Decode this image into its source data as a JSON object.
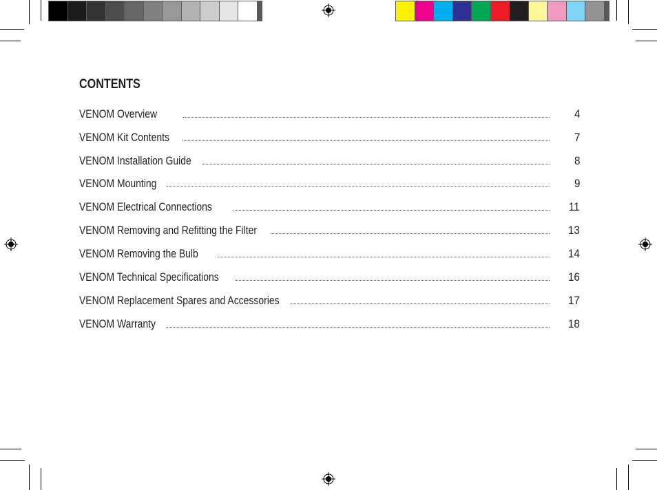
{
  "document": {
    "title": "CONTENTS",
    "toc": [
      {
        "label": "VENOM Overview",
        "page": "4"
      },
      {
        "label": "VENOM Kit Contents",
        "page": "7"
      },
      {
        "label": "VENOM Installation Guide",
        "page": "8"
      },
      {
        "label": "VENOM Mounting",
        "page": "9"
      },
      {
        "label": "VENOM Electrical Connections",
        "page": "11"
      },
      {
        "label": "VENOM Removing and Refitting the Filter",
        "page": "13"
      },
      {
        "label": "VENOM Removing the Bulb",
        "page": "14"
      },
      {
        "label": "VENOM Technical Specifications",
        "page": "16"
      },
      {
        "label": "VENOM Replacement Spares and Accessories",
        "page": "17"
      },
      {
        "label": "VENOM Warranty",
        "page": "18"
      }
    ]
  },
  "print_marks": {
    "grayscale_bar": [
      "#000000",
      "#1c1c1c",
      "#333333",
      "#4d4d4d",
      "#666666",
      "#808080",
      "#999999",
      "#b3b3b3",
      "#cccccc",
      "#e6e6e6",
      "#ffffff"
    ],
    "color_bar": [
      "#fff200",
      "#ec008c",
      "#00aeef",
      "#2e3192",
      "#00a651",
      "#ed1c24",
      "#231f20",
      "#fff799",
      "#f49ac1",
      "#7fd4f7",
      "#939393"
    ]
  }
}
